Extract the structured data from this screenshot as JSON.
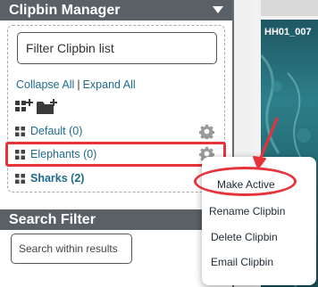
{
  "clipbin_manager": {
    "title": "Clipbin Manager",
    "filter_placeholder": "Filter Clipbin list",
    "collapse_all": "Collapse All",
    "separator": "|",
    "expand_all": "Expand All",
    "clipbins": [
      {
        "label": "Default (0)"
      },
      {
        "label": "Elephants (0)"
      },
      {
        "label": "Sharks (2)"
      }
    ]
  },
  "search_filter": {
    "title": "Search Filter",
    "placeholder": "Search within results"
  },
  "thumbnail": {
    "label": "HH01_007"
  },
  "context_menu": {
    "items": [
      {
        "label": "Make Active"
      },
      {
        "label": "Rename Clipbin"
      },
      {
        "label": "Delete Clipbin"
      },
      {
        "label": "Email Clipbin"
      }
    ]
  },
  "colors": {
    "header_bg": "#596166",
    "link": "#1f6a8c",
    "highlight": "#e8323a"
  }
}
